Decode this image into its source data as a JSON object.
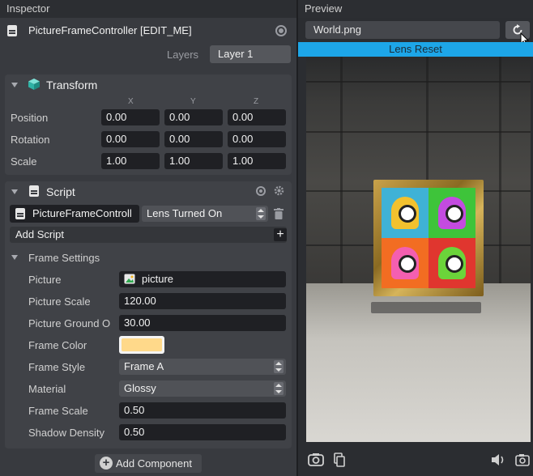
{
  "inspector": {
    "title": "Inspector",
    "object_name": "PictureFrameController [EDIT_ME]",
    "layers_label": "Layers",
    "layer_value": "Layer 1",
    "transform": {
      "title": "Transform",
      "axes": [
        "X",
        "Y",
        "Z"
      ],
      "rows": [
        {
          "label": "Position",
          "values": [
            "0.00",
            "0.00",
            "0.00"
          ]
        },
        {
          "label": "Rotation",
          "values": [
            "0.00",
            "0.00",
            "0.00"
          ]
        },
        {
          "label": "Scale",
          "values": [
            "1.00",
            "1.00",
            "1.00"
          ]
        }
      ]
    },
    "script": {
      "title": "Script",
      "script_name": "PictureFrameControll",
      "event": "Lens Turned On",
      "add_script": "Add Script",
      "frame_settings_title": "Frame Settings",
      "props": {
        "picture_label": "Picture",
        "picture_value": "picture",
        "picture_scale_label": "Picture Scale",
        "picture_scale_value": "120.00",
        "ground_label": "Picture Ground O",
        "ground_value": "30.00",
        "frame_color_label": "Frame Color",
        "frame_color": "#ffd98a",
        "frame_style_label": "Frame Style",
        "frame_style_value": "Frame A",
        "material_label": "Material",
        "material_value": "Glossy",
        "frame_scale_label": "Frame Scale",
        "frame_scale_value": "0.50",
        "shadow_label": "Shadow Density",
        "shadow_value": "0.50"
      }
    },
    "add_component": "Add Component"
  },
  "preview": {
    "title": "Preview",
    "world_file": "World.png",
    "lens_reset": "Lens Reset",
    "accent": "#1da6e8"
  }
}
